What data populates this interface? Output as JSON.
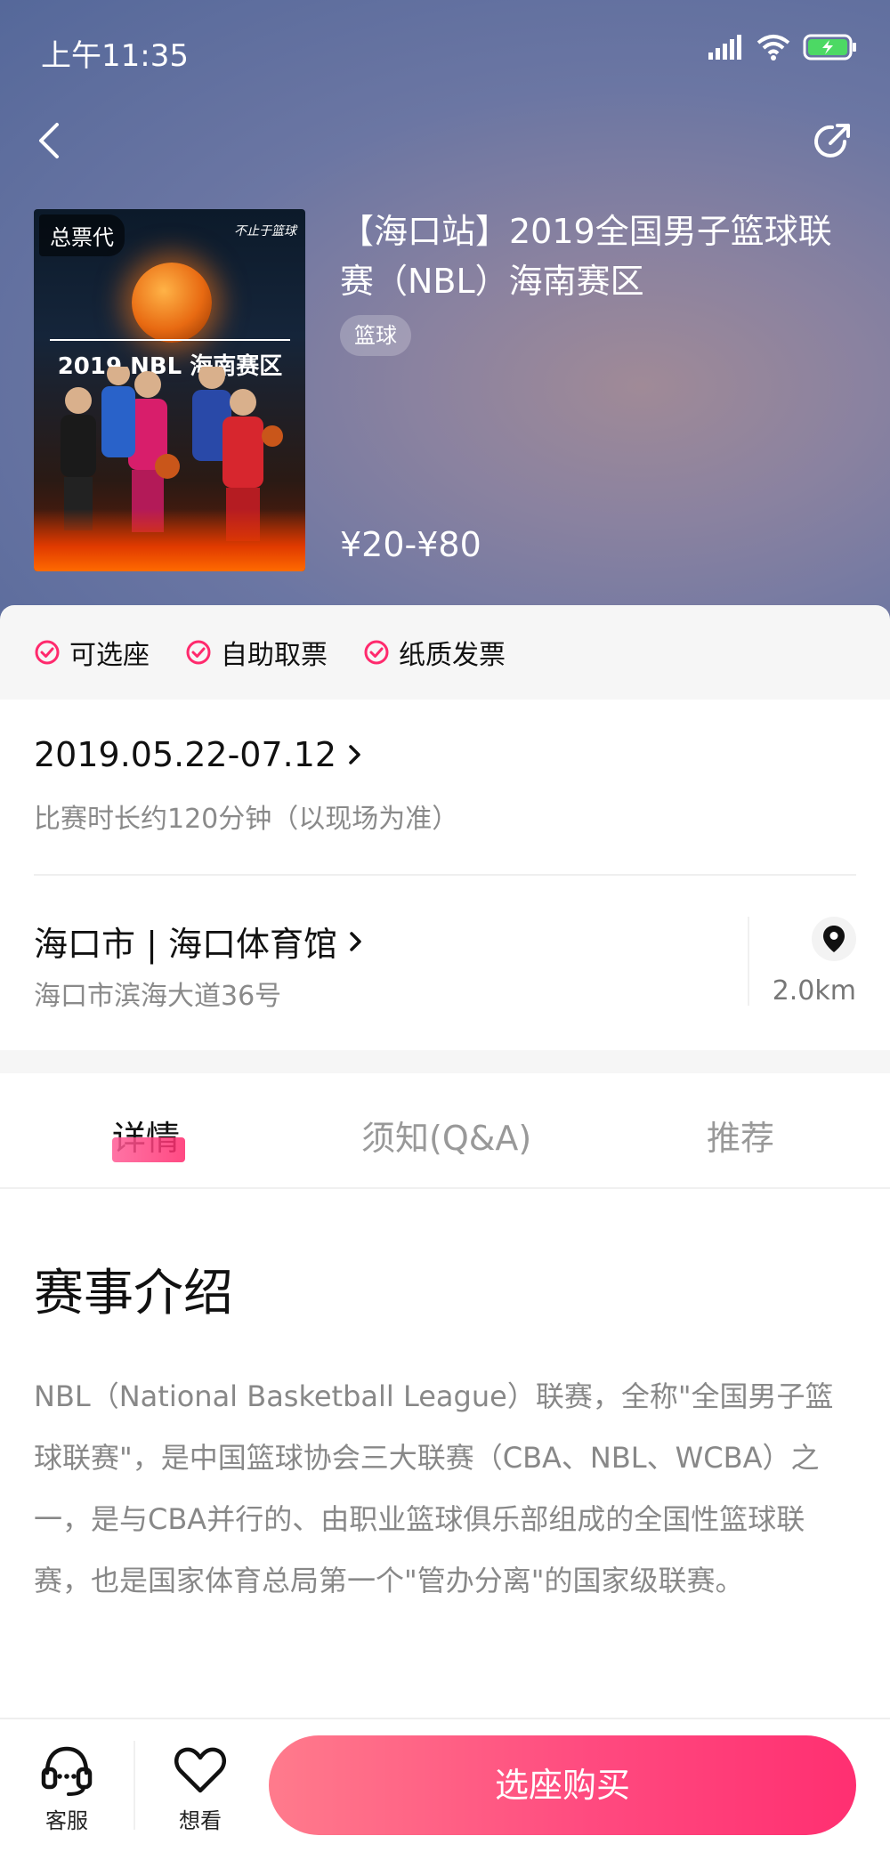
{
  "status_bar": {
    "time": "上午11:35"
  },
  "poster": {
    "badge": "总票代",
    "tagline": "不止于篮球",
    "title": "2019 NBL 海南赛区"
  },
  "event": {
    "title": "【海口站】2019全国男子篮球联赛（NBL）海南赛区",
    "tag": "篮球",
    "price": "¥20-¥80"
  },
  "features": [
    "可选座",
    "自助取票",
    "纸质发票"
  ],
  "schedule": {
    "date": "2019.05.22-07.12",
    "duration": "比赛时长约120分钟（以现场为准）"
  },
  "venue": {
    "name": "海口市 | 海口体育馆",
    "address": "海口市滨海大道36号",
    "distance": "2.0km"
  },
  "tabs": [
    {
      "label": "详情"
    },
    {
      "label": "须知(Q&A)"
    },
    {
      "label": "推荐"
    }
  ],
  "content": {
    "section_title": "赛事介绍",
    "intro": "NBL（National Basketball League）联赛，全称\"全国男子篮球联赛\"，是中国篮球协会三大联赛（CBA、NBL、WCBA）之一，是与CBA并行的、由职业篮球俱乐部组成的全国性篮球联赛，也是国家体育总局第一个\"管办分离\"的国家级联赛。"
  },
  "bottom_bar": {
    "service_label": "客服",
    "wish_label": "想看",
    "buy_label": "选座购买"
  },
  "colors": {
    "accent": "#ff2a6d",
    "header": "#5f6fa0"
  },
  "icons": [
    "signal-icon",
    "wifi-icon",
    "battery-icon",
    "back-icon",
    "share-icon",
    "check-circle-icon",
    "map-pin-icon",
    "headset-icon",
    "heart-icon"
  ]
}
